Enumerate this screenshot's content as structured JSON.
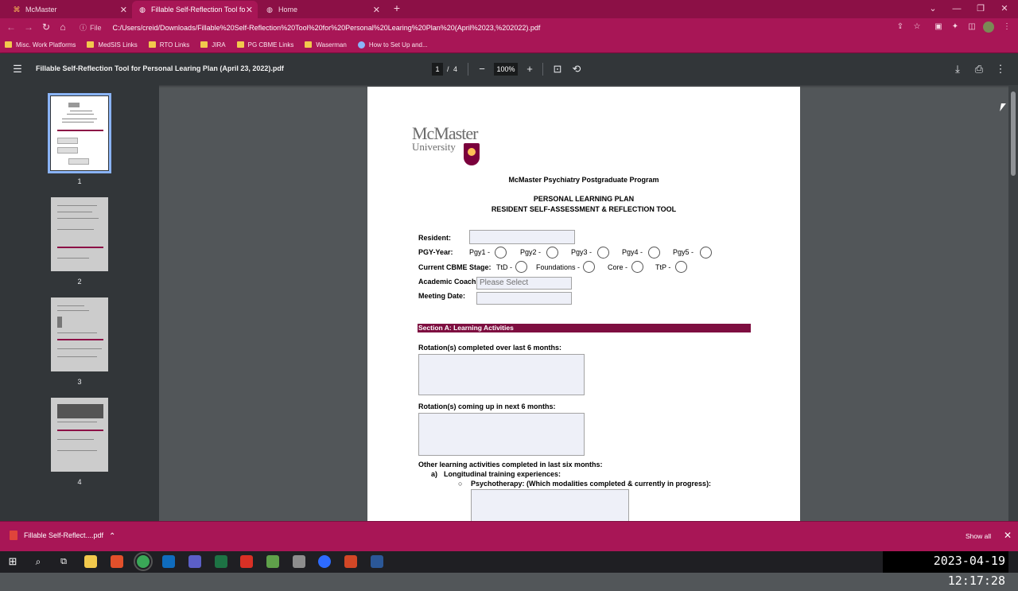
{
  "browser": {
    "tabs": [
      {
        "label": "McMaster"
      },
      {
        "label": "Fillable Self-Reflection Tool for P"
      },
      {
        "label": "Home"
      }
    ],
    "file_label": "File",
    "url": "C:/Users/creid/Downloads/Fillable%20Self-Reflection%20Tool%20for%20Personal%20Learing%20Plan%20(April%2023,%202022).pdf",
    "bookmarks": [
      {
        "label": "Misc. Work Platforms",
        "icon": "folder-icon"
      },
      {
        "label": "MedSIS Links",
        "icon": "folder-icon"
      },
      {
        "label": "RTO Links",
        "icon": "folder-icon"
      },
      {
        "label": "JIRA",
        "icon": "folder-icon"
      },
      {
        "label": "PG CBME Links",
        "icon": "folder-icon"
      },
      {
        "label": "Waserman",
        "icon": "folder-icon"
      },
      {
        "label": "How to Set Up and...",
        "icon": "globe-icon"
      }
    ]
  },
  "pdf_toolbar": {
    "title": "Fillable Self-Reflection Tool for Personal Learing Plan (April 23, 2022).pdf",
    "current_page": "1",
    "page_separator": "/",
    "total_pages": "4",
    "zoom": "100%"
  },
  "sidebar": {
    "thumbnails": [
      {
        "number": "1"
      },
      {
        "number": "2"
      },
      {
        "number": "3"
      },
      {
        "number": "4"
      }
    ]
  },
  "document": {
    "logo_line1": "McMaster",
    "logo_line2": "University",
    "program": "McMaster Psychiatry Postgraduate Program",
    "heading1": "PERSONAL LEARNING PLAN",
    "heading2": "RESIDENT SELF-ASSESSMENT & REFLECTION TOOL",
    "resident_label": "Resident:",
    "pgy_label": "PGY-Year:",
    "pgy_options": [
      "Pgy1 -",
      "Pgy2 -",
      "Pgy3 -",
      "Pgy4 -",
      "Pgy5 -"
    ],
    "cbme_label": "Current CBME Stage:",
    "cbme_options": [
      "TtD -",
      "Foundations -",
      "Core -",
      "TtP -"
    ],
    "coach_label": "Academic Coach:",
    "coach_value": "Please Select",
    "meeting_label": "Meeting Date:",
    "section_a": "Section A:  Learning Activities",
    "rotations_past": "Rotation(s) completed over last 6 months:",
    "rotations_next": "Rotation(s) coming up in next 6 months:",
    "other_activities": "Other learning activities completed in last six months:",
    "item_a_marker": "a)",
    "item_a": "Longitudinal training experiences:",
    "bullet": "○",
    "psychotherapy": "Psychotherapy: (Which modalities completed & currently in progress):"
  },
  "download_bar": {
    "file": "Fillable Self-Reflect....pdf",
    "show_all": "Show all"
  },
  "taskbar": {
    "clock": "2023-04-19 12:17:28"
  },
  "colors": {
    "brand_maroon": "#7e0e40",
    "browser_frame": "#a81656",
    "pdf_toolbar": "#323639"
  }
}
